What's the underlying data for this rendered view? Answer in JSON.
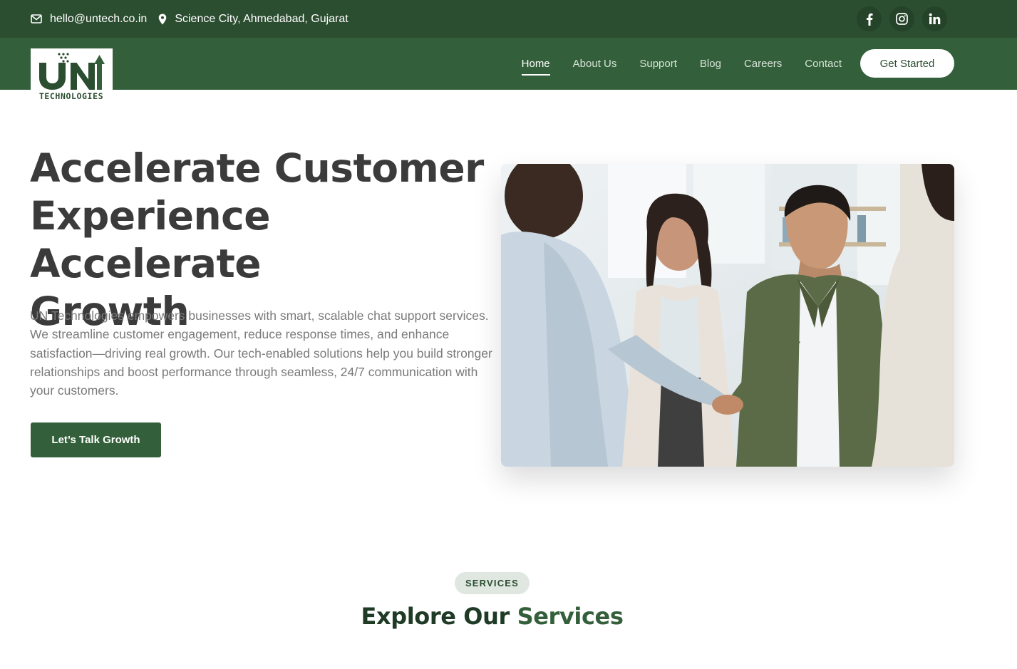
{
  "topbar": {
    "email": "hello@untech.co.in",
    "location": "Science City, Ahmedabad, Gujarat",
    "socials": [
      {
        "icon": "facebook-icon"
      },
      {
        "icon": "instagram-icon"
      },
      {
        "icon": "linkedin-icon"
      }
    ]
  },
  "brand": {
    "logo_mark": "UN",
    "logo_sub": "TECHNOLOGIES"
  },
  "nav": {
    "items": [
      "Home",
      "About Us",
      "Support",
      "Blog",
      "Careers",
      "Contact"
    ],
    "active": "Home",
    "cta_label": "Get Started"
  },
  "hero": {
    "title_lines": [
      "Accelerate Customer",
      "Experience Accelerate",
      "Growth"
    ],
    "description": "UN Technologies empowers businesses with smart, scalable chat support services. We streamline customer engagement, reduce response times, and enhance satisfaction—driving real growth. Our tech-enabled solutions help you build stronger relationships and boost performance through seamless, 24/7 communication with your customers.",
    "button_label": "Let’s Talk Growth"
  },
  "services": {
    "badge": "SERVICES",
    "title_prefix": "Explore Our",
    "title_accent": "Services"
  },
  "colors": {
    "topbar": "#2b4d30",
    "navbar": "#33603a",
    "accent": "#33603a",
    "heading": "#3b3b3b"
  }
}
